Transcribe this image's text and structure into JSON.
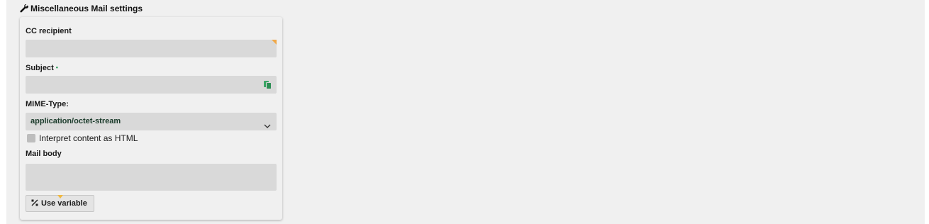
{
  "section": {
    "title": "Miscellaneous Mail settings",
    "icon": "wrench-icon"
  },
  "form": {
    "cc_recipient": {
      "label": "CC recipient",
      "value": ""
    },
    "subject": {
      "label": "Subject",
      "required_marker": "•",
      "value": "",
      "icon": "copy-icon"
    },
    "mime_type": {
      "label": "MIME-Type:",
      "selected": "application/octet-stream",
      "icon": "chevron-down-icon"
    },
    "interpret_html": {
      "label": "Interpret content as HTML",
      "checked": false
    },
    "mail_body": {
      "label": "Mail body",
      "value": ""
    },
    "use_variable": {
      "label": "Use variable",
      "icon": "variable-icon"
    }
  },
  "colors": {
    "background": "#f0f0f0",
    "field": "#d9d9d9",
    "accent_orange": "#f0a848",
    "accent_green": "#2e9d5a"
  }
}
